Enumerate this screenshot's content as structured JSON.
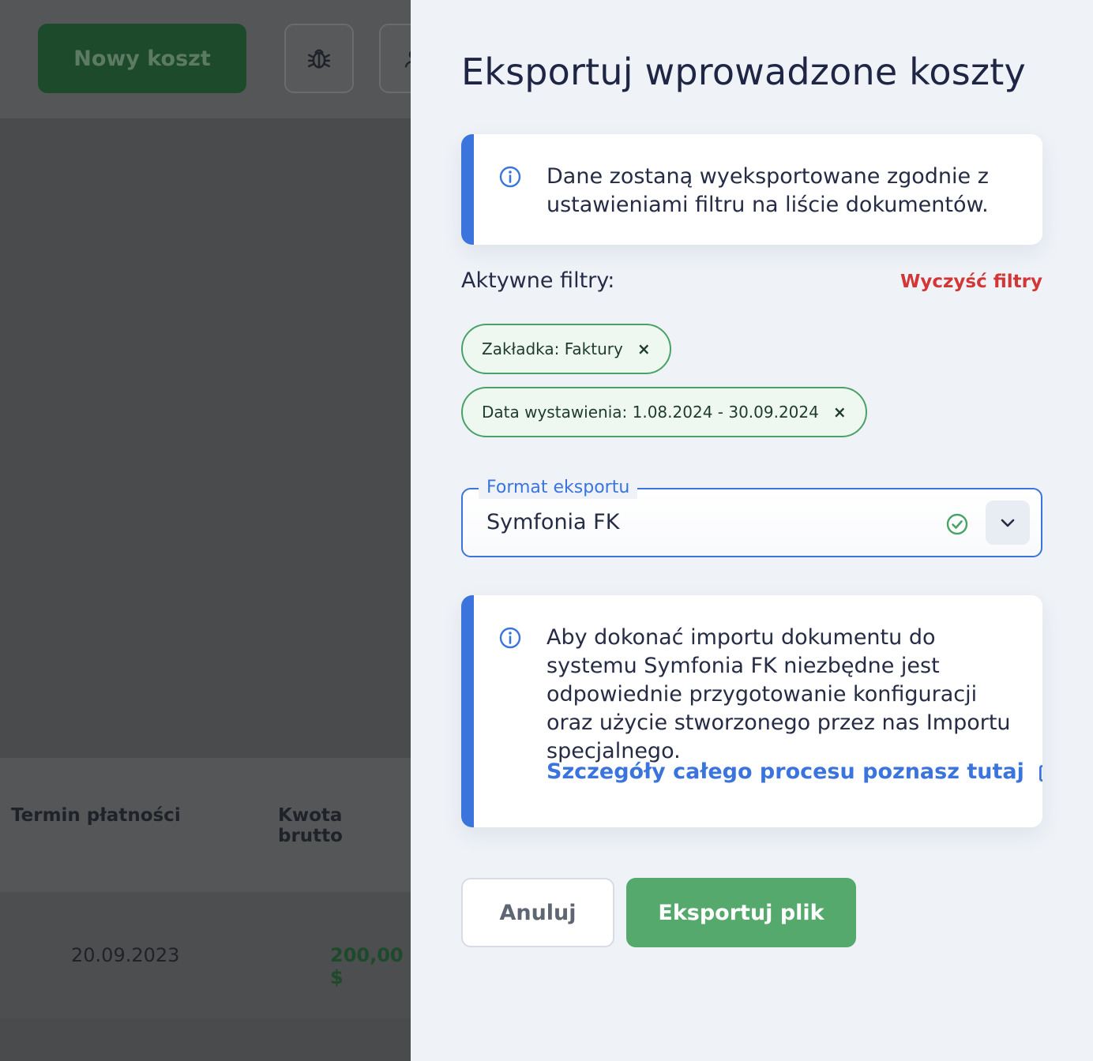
{
  "background": {
    "new_cost_button": "Nowy koszt",
    "icons": [
      "bug-icon",
      "user-icon"
    ],
    "table": {
      "headers": [
        "Termin płatności",
        "Kwota brutto"
      ],
      "rows": [
        {
          "due_date": "20.09.2023",
          "gross_amount": "200,00 $"
        }
      ]
    }
  },
  "drawer": {
    "title": "Eksportuj wprowadzone koszty",
    "info_top": "Dane zostaną wyeksportowane zgodnie z ustawieniami filtru na liście dokumentów.",
    "active_filters_label": "Aktywne filtry:",
    "clear_filters": "Wyczyść filtry",
    "chips": [
      {
        "label": "Zakładka: Faktury",
        "remove": "×"
      },
      {
        "label": "Data wystawienia: 1.08.2024 - 30.09.2024",
        "remove": "×"
      }
    ],
    "format": {
      "label": "Format eksportu",
      "value": "Symfonia FK",
      "status": "valid"
    },
    "info_bottom": {
      "text": "Aby dokonać importu dokumentu do systemu Symfonia FK niezbędne jest odpowiednie przygotowanie konfiguracji oraz użycie stworzonego przez nas Importu specjalnego.",
      "link": "Szczegóły całego procesu poznasz tutaj"
    },
    "buttons": {
      "cancel": "Anuluj",
      "export": "Eksportuj plik"
    }
  },
  "colors": {
    "accent_blue": "#3b74dc",
    "danger_red": "#d23636",
    "success_green": "#55a96c",
    "chip_border": "#4aa265",
    "title": "#1f2544",
    "overlay": "#4a4b4d"
  }
}
